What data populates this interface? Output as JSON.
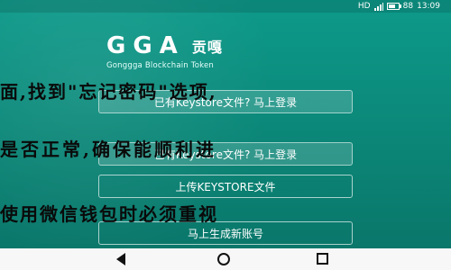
{
  "status_bar": {
    "network": "HD",
    "battery": "88",
    "time": "13:09"
  },
  "logo": {
    "main": "GGA",
    "cn": "贡嘎",
    "subtitle": "Gonggga Blockchain Token"
  },
  "buttons": {
    "import_mnemonic": "已有Keystore文件?  马上登录",
    "upload_keystore": "上传KEYSTORE文件",
    "create_account": "马上生成新账号"
  },
  "overlay_text": {
    "line1": "面,找到\"忘记密码\"选项,",
    "line2": "是否正常,确保能顺利进",
    "line3": "使用微信钱包时必须重视"
  },
  "colors": {
    "background": "#0c8f80",
    "overlay_text": "#0a0a0a",
    "nav_bar": "#f7f7f7"
  }
}
